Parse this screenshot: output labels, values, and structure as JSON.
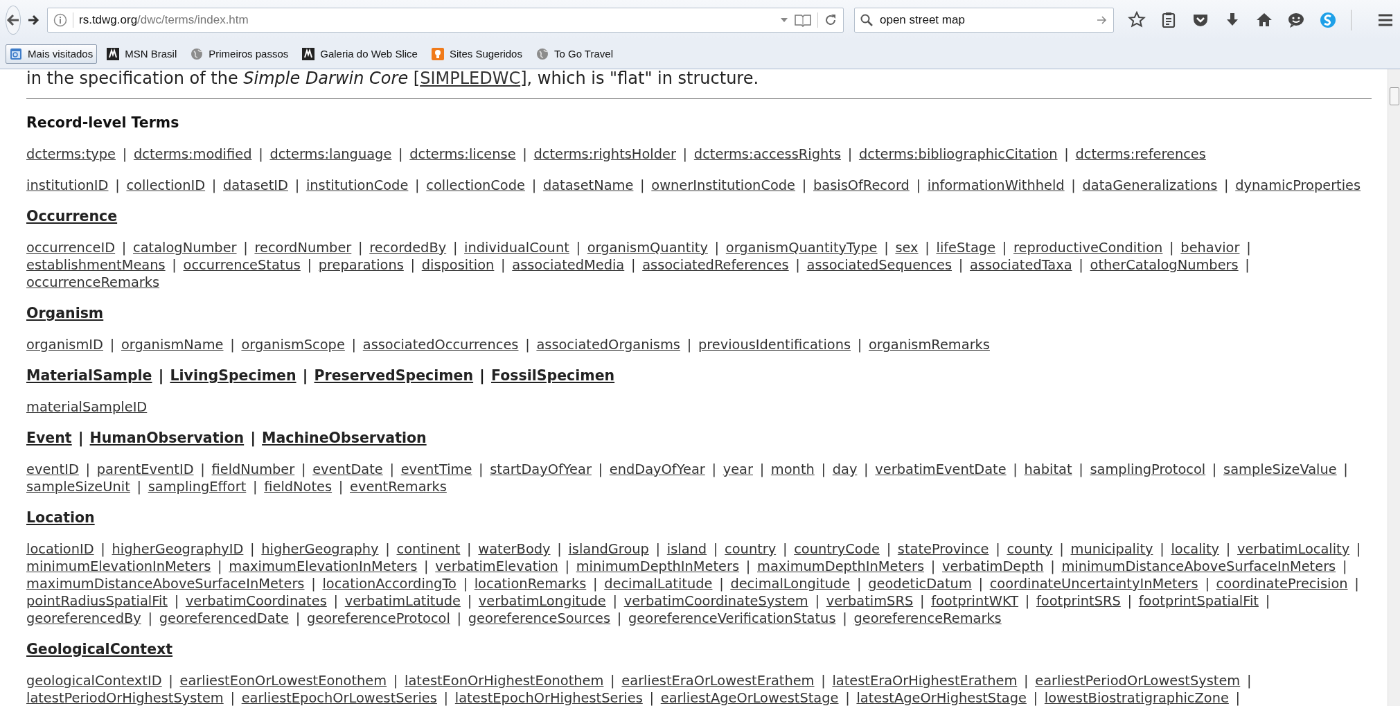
{
  "browser": {
    "url": {
      "host": "rs.tdwg.org",
      "path": "/dwc/terms/index.htm"
    },
    "search": {
      "value": "open street map"
    },
    "bookmarks": [
      {
        "label": "Mais visitados",
        "hovered": true
      },
      {
        "label": "MSN Brasil",
        "hovered": false
      },
      {
        "label": "Primeiros passos",
        "hovered": false
      },
      {
        "label": "Galeria do Web Slice",
        "hovered": false
      },
      {
        "label": "Sites Sugeridos",
        "hovered": false
      },
      {
        "label": "To Go Travel",
        "hovered": false
      }
    ]
  },
  "page": {
    "intro": {
      "before": "in the specification of the *Simple Darwin Core* [",
      "link": "SIMPLEDWC",
      "after": "], which is \"flat\" in structure."
    },
    "separator": "|",
    "sections": [
      {
        "heading": [
          {
            "text": "Record-level Terms",
            "link": false
          }
        ],
        "paragraphs": [
          {
            "lines": [
              [
                "dcterms:type",
                "dcterms:modified",
                "dcterms:language",
                "dcterms:license",
                "dcterms:rightsHolder",
                "dcterms:accessRights",
                "dcterms:bibliographicCitation",
                "dcterms:references"
              ]
            ]
          },
          {
            "lines": [
              [
                "institutionID",
                "collectionID",
                "datasetID",
                "institutionCode",
                "collectionCode",
                "datasetName",
                "ownerInstitutionCode",
                "basisOfRecord",
                "informationWithheld",
                "dataGeneralizations",
                "dynamicProperties"
              ]
            ]
          }
        ]
      },
      {
        "heading": [
          {
            "text": "Occurrence",
            "link": true
          }
        ],
        "paragraphs": [
          {
            "lines": [
              [
                "occurrenceID",
                "catalogNumber",
                "recordNumber",
                "recordedBy",
                "individualCount",
                "organismQuantity",
                "organismQuantityType",
                "sex",
                "lifeStage",
                "reproductiveCondition",
                "behavior"
              ],
              [
                "establishmentMeans",
                "occurrenceStatus",
                "preparations",
                "disposition",
                "associatedMedia",
                "associatedReferences",
                "associatedSequences",
                "associatedTaxa",
                "otherCatalogNumbers"
              ],
              [
                "occurrenceRemarks"
              ]
            ]
          }
        ]
      },
      {
        "heading": [
          {
            "text": "Organism",
            "link": true
          }
        ],
        "paragraphs": [
          {
            "lines": [
              [
                "organismID",
                "organismName",
                "organismScope",
                "associatedOccurrences",
                "associatedOrganisms",
                "previousIdentifications",
                "organismRemarks"
              ]
            ]
          }
        ]
      },
      {
        "heading": [
          {
            "text": "MaterialSample",
            "link": true
          },
          {
            "text": "LivingSpecimen",
            "link": true
          },
          {
            "text": "PreservedSpecimen",
            "link": true
          },
          {
            "text": "FossilSpecimen",
            "link": true
          }
        ],
        "paragraphs": [
          {
            "lines": [
              [
                "materialSampleID"
              ]
            ]
          }
        ]
      },
      {
        "heading": [
          {
            "text": "Event",
            "link": true
          },
          {
            "text": "HumanObservation",
            "link": true
          },
          {
            "text": "MachineObservation",
            "link": true
          }
        ],
        "paragraphs": [
          {
            "lines": [
              [
                "eventID",
                "parentEventID",
                "fieldNumber",
                "eventDate",
                "eventTime",
                "startDayOfYear",
                "endDayOfYear",
                "year",
                "month",
                "day",
                "verbatimEventDate",
                "habitat",
                "samplingProtocol",
                "sampleSizeValue"
              ],
              [
                "sampleSizeUnit",
                "samplingEffort",
                "fieldNotes",
                "eventRemarks"
              ]
            ]
          }
        ]
      },
      {
        "heading": [
          {
            "text": "Location",
            "link": true
          }
        ],
        "paragraphs": [
          {
            "lines": [
              [
                "locationID",
                "higherGeographyID",
                "higherGeography",
                "continent",
                "waterBody",
                "islandGroup",
                "island",
                "country",
                "countryCode",
                "stateProvince",
                "county",
                "municipality",
                "locality",
                "verbatimLocality"
              ],
              [
                "minimumElevationInMeters",
                "maximumElevationInMeters",
                "verbatimElevation",
                "minimumDepthInMeters",
                "maximumDepthInMeters",
                "verbatimDepth",
                "minimumDistanceAboveSurfaceInMeters"
              ],
              [
                "maximumDistanceAboveSurfaceInMeters",
                "locationAccordingTo",
                "locationRemarks",
                "decimalLatitude",
                "decimalLongitude",
                "geodeticDatum",
                "coordinateUncertaintyInMeters",
                "coordinatePrecision"
              ],
              [
                "pointRadiusSpatialFit",
                "verbatimCoordinates",
                "verbatimLatitude",
                "verbatimLongitude",
                "verbatimCoordinateSystem",
                "verbatimSRS",
                "footprintWKT",
                "footprintSRS",
                "footprintSpatialFit"
              ],
              [
                "georeferencedBy",
                "georeferencedDate",
                "georeferenceProtocol",
                "georeferenceSources",
                "georeferenceVerificationStatus",
                "georeferenceRemarks"
              ]
            ]
          }
        ]
      },
      {
        "heading": [
          {
            "text": "GeologicalContext",
            "link": true
          }
        ],
        "paragraphs": [
          {
            "more": true,
            "lines": [
              [
                "geologicalContextID",
                "earliestEonOrLowestEonothem",
                "latestEonOrHighestEonothem",
                "earliestEraOrLowestErathem",
                "latestEraOrHighestErathem",
                "earliestPeriodOrLowestSystem"
              ],
              [
                "latestPeriodOrHighestSystem",
                "earliestEpochOrLowestSeries",
                "latestEpochOrHighestSeries",
                "earliestAgeOrLowestStage",
                "latestAgeOrHighestStage",
                "lowestBiostratigraphicZone"
              ]
            ]
          }
        ]
      }
    ]
  }
}
